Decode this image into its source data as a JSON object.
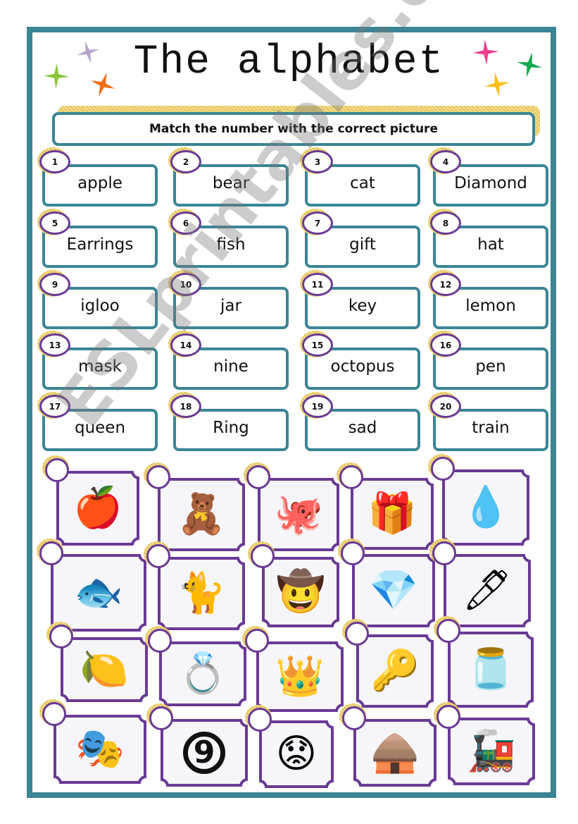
{
  "title": "The alphabet",
  "instruction": "Match the number with the correct picture",
  "watermark": "ESLprintables.com",
  "colors": {
    "frame": "#3b8595",
    "badge_border": "#6a3a94",
    "picture_border": "#6a3a94",
    "glow": "#e6c866"
  },
  "stars": [
    {
      "name": "star-lavender",
      "color": "#b6a4cf"
    },
    {
      "name": "star-green",
      "color": "#8cc63f"
    },
    {
      "name": "star-orange",
      "color": "#ef6c14"
    },
    {
      "name": "star-pink",
      "color": "#ec3f8e"
    },
    {
      "name": "star-emerald",
      "color": "#13a84f"
    },
    {
      "name": "star-yellow",
      "color": "#fbbf1a"
    }
  ],
  "words": [
    {
      "num": "1",
      "word": "apple"
    },
    {
      "num": "2",
      "word": "bear"
    },
    {
      "num": "3",
      "word": "cat"
    },
    {
      "num": "4",
      "word": "Diamond"
    },
    {
      "num": "5",
      "word": "Earrings"
    },
    {
      "num": "6",
      "word": "fish"
    },
    {
      "num": "7",
      "word": "gift"
    },
    {
      "num": "8",
      "word": "hat"
    },
    {
      "num": "9",
      "word": "igloo"
    },
    {
      "num": "10",
      "word": "jar"
    },
    {
      "num": "11",
      "word": "key"
    },
    {
      "num": "12",
      "word": "lemon"
    },
    {
      "num": "13",
      "word": "mask"
    },
    {
      "num": "14",
      "word": "nine"
    },
    {
      "num": "15",
      "word": "octopus"
    },
    {
      "num": "16",
      "word": "pen"
    },
    {
      "num": "17",
      "word": "queen"
    },
    {
      "num": "18",
      "word": "Ring"
    },
    {
      "num": "19",
      "word": "sad"
    },
    {
      "num": "20",
      "word": "train"
    }
  ],
  "pictures": [
    {
      "name": "apple",
      "glyph": "🍎"
    },
    {
      "name": "teddy-bear",
      "glyph": "🧸"
    },
    {
      "name": "octopus",
      "glyph": "🐙"
    },
    {
      "name": "gift",
      "glyph": "🎁"
    },
    {
      "name": "earrings",
      "glyph": "💧"
    },
    {
      "name": "fish",
      "glyph": "🐟"
    },
    {
      "name": "cat",
      "glyph": "🐈"
    },
    {
      "name": "hat",
      "glyph": "🤠"
    },
    {
      "name": "diamond",
      "glyph": "💎"
    },
    {
      "name": "pen",
      "glyph": "🖊"
    },
    {
      "name": "lemon",
      "glyph": "🍋"
    },
    {
      "name": "ring",
      "glyph": "💍"
    },
    {
      "name": "queen",
      "glyph": "👑"
    },
    {
      "name": "key",
      "glyph": "🔑"
    },
    {
      "name": "jar",
      "glyph": "🫙"
    },
    {
      "name": "mask",
      "glyph": "🎭"
    },
    {
      "name": "nine",
      "glyph": "9"
    },
    {
      "name": "sad-face",
      "glyph": "😟"
    },
    {
      "name": "igloo",
      "glyph": "🛖"
    },
    {
      "name": "train",
      "glyph": "🚂"
    }
  ]
}
